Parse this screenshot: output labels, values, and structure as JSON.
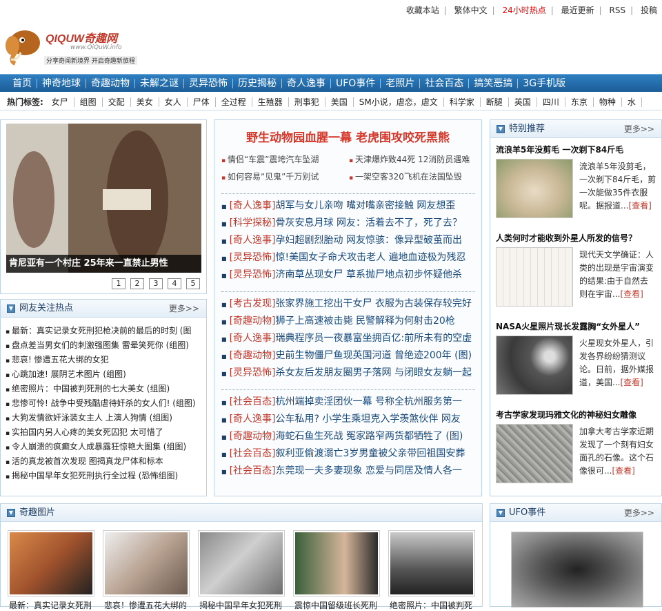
{
  "topbar": {
    "links": [
      "收藏本站",
      "繁体中文",
      "24小时热点",
      "最近更新",
      "RSS",
      "投稿"
    ]
  },
  "logo": {
    "name": "QIQUW奇趣网",
    "domain": "www.QiQuW.info",
    "slogan": "分享奇闻新境界 开启奇趣新旅程"
  },
  "nav": {
    "items": [
      "首页",
      "神奇地球",
      "奇趣动物",
      "未解之谜",
      "灵异恐怖",
      "历史揭秘",
      "奇人逸事",
      "UFO事件",
      "老照片",
      "社会百态",
      "搞笑恶搞",
      "3G手机版"
    ]
  },
  "tags": {
    "label": "热门标签:",
    "items": [
      "女尸",
      "组图",
      "交配",
      "美女",
      "女人",
      "尸体",
      "全过程",
      "生殖器",
      "刑事犯",
      "美国",
      "SM小说，虐恋，虐文",
      "科学家",
      "断腿",
      "英国",
      "四川",
      "东京",
      "物种",
      "水"
    ]
  },
  "feature": {
    "caption": "肯尼亚有一个村庄 25年来一直禁止男性",
    "pages": [
      "1",
      "2",
      "3",
      "4",
      "5"
    ]
  },
  "hotfocus": {
    "title": "网友关注热点",
    "more": "更多>>",
    "items": [
      "最新：真实记录女死刑犯枪决前的最后的时刻 (图",
      "盘点差当男女们的刺激强图集 雷晕笑死你 (组图)",
      "悲哀! 惨遭五花大绑的女犯",
      "心跳加速! 展阴艺术图片 (组图)",
      "绝密照片：中国被判死刑的七大美女 (组图)",
      "悲惨可怜! 战争中受残酷虐待奸杀的女人们! (组图)",
      "大狗发情欲奸泳装女主人 上演人狗情 (组图)",
      "实拍国内另人心疼的美女死囚犯 太可惜了",
      "令人崩溃的疯癫女人成暴露狂惊艳大图集 (组图)",
      "活的真龙被首次发现 图揭真龙尸体和标本",
      "揭秘中国早年女犯死刑执行全过程 (恐怖组图)"
    ]
  },
  "middle": {
    "headline": "野生动物园血腥一幕 老虎围攻咬死黑熊",
    "sublinks": [
      "情侣“车震”震垮汽车坠湖",
      "天津爆炸致44死 12消防员遇难",
      "如何容易“见鬼”千万别试",
      "一架空客320飞机在法国坠毁"
    ],
    "groups": [
      [
        {
          "cat": "[奇人逸事]",
          "title": "胡军与女儿亲吻 嘴对嘴亲密接触 网友想歪"
        },
        {
          "cat": "[科学探秘]",
          "title": "骨灰安息月球 网友：活着去不了，死了去？"
        },
        {
          "cat": "[奇人逸事]",
          "title": "孕妇超剧烈胎动 网友惊骇：像异型破茧而出"
        },
        {
          "cat": "[灵异恐怖]",
          "title": "惊!美国女子命犬攻击老人 遍地血迹极为残忍"
        },
        {
          "cat": "[灵异恐怖]",
          "title": "济南草丛现女尸 草系抛尸地点初步怀疑他杀"
        }
      ],
      [
        {
          "cat": "[考古发现]",
          "title": "张家界施工挖出干女尸 衣服为古装保存较完好"
        },
        {
          "cat": "[奇趣动物]",
          "title": "狮子上高速被击毙 民警解释为何射击20枪"
        },
        {
          "cat": "[奇人逸事]",
          "title": "瑞典程序员一夜暴富坐拥百亿:前所未有的空虚"
        },
        {
          "cat": "[奇趣动物]",
          "title": "史前生物僵尸鱼现英国河道 曾绝迹200年 (图)"
        },
        {
          "cat": "[灵异恐怖]",
          "title": "杀女友后发朋友圈男子落网 与闭眼女友躺一起"
        }
      ],
      [
        {
          "cat": "[社会百态]",
          "title": "杭州端掉卖淫团伙一幕 号称全杭州服务第一"
        },
        {
          "cat": "[奇人逸事]",
          "title": "公车私用? 小学生乘坦克入学羡煞伙伴 网友"
        },
        {
          "cat": "[奇趣动物]",
          "title": "海蛇石鱼生死战 冤家路窄两货都牺牲了 (图)"
        },
        {
          "cat": "[社会百态]",
          "title": "叙利亚偷渡溺亡3岁男童被父亲带回祖国安葬"
        },
        {
          "cat": "[社会百态]",
          "title": "东莞现一夫多妻现象 恋爱与同居及情人各一"
        }
      ]
    ]
  },
  "special": {
    "title": "特别推荐",
    "more": "更多>>",
    "items": [
      {
        "title": "流浪羊5年没剪毛 一次剃下84斤毛",
        "text": "流浪羊5年没剪毛，一次剃下84斤毛，剪一次能做35件衣服呢。据报道...",
        "link": "[查看]"
      },
      {
        "title": "人类何时才能收到外星人所发的信号？",
        "text": "现代天文学确证：人类的出现是宇宙演变的结果:由于自然去则在宇宙...",
        "link": "[查看]"
      },
      {
        "title": "NASA火星照片现长发露胸“女外星人”",
        "text": "火星现女外星人，引发各界纷纷猜测议论。日前，据外媒报道，美国...",
        "link": "[查看]"
      },
      {
        "title": "考古学家发现玛雅文化的神秘妇女雕像",
        "text": "加拿大考古学家近期发现了一个刻有妇女面孔的石像。这个石像很可...",
        "link": "[查看]"
      }
    ]
  },
  "qiqu": {
    "title": "奇趣图片",
    "captions": [
      "最新：真实记录女死刑",
      "悲哀！惨遭五花大绑的",
      "揭秘中国早年女犯死刑",
      "震惊中国留级班长死刑",
      "绝密照片：中国被判死"
    ]
  },
  "ufo": {
    "title": "UFO事件",
    "more": "更多>>"
  }
}
